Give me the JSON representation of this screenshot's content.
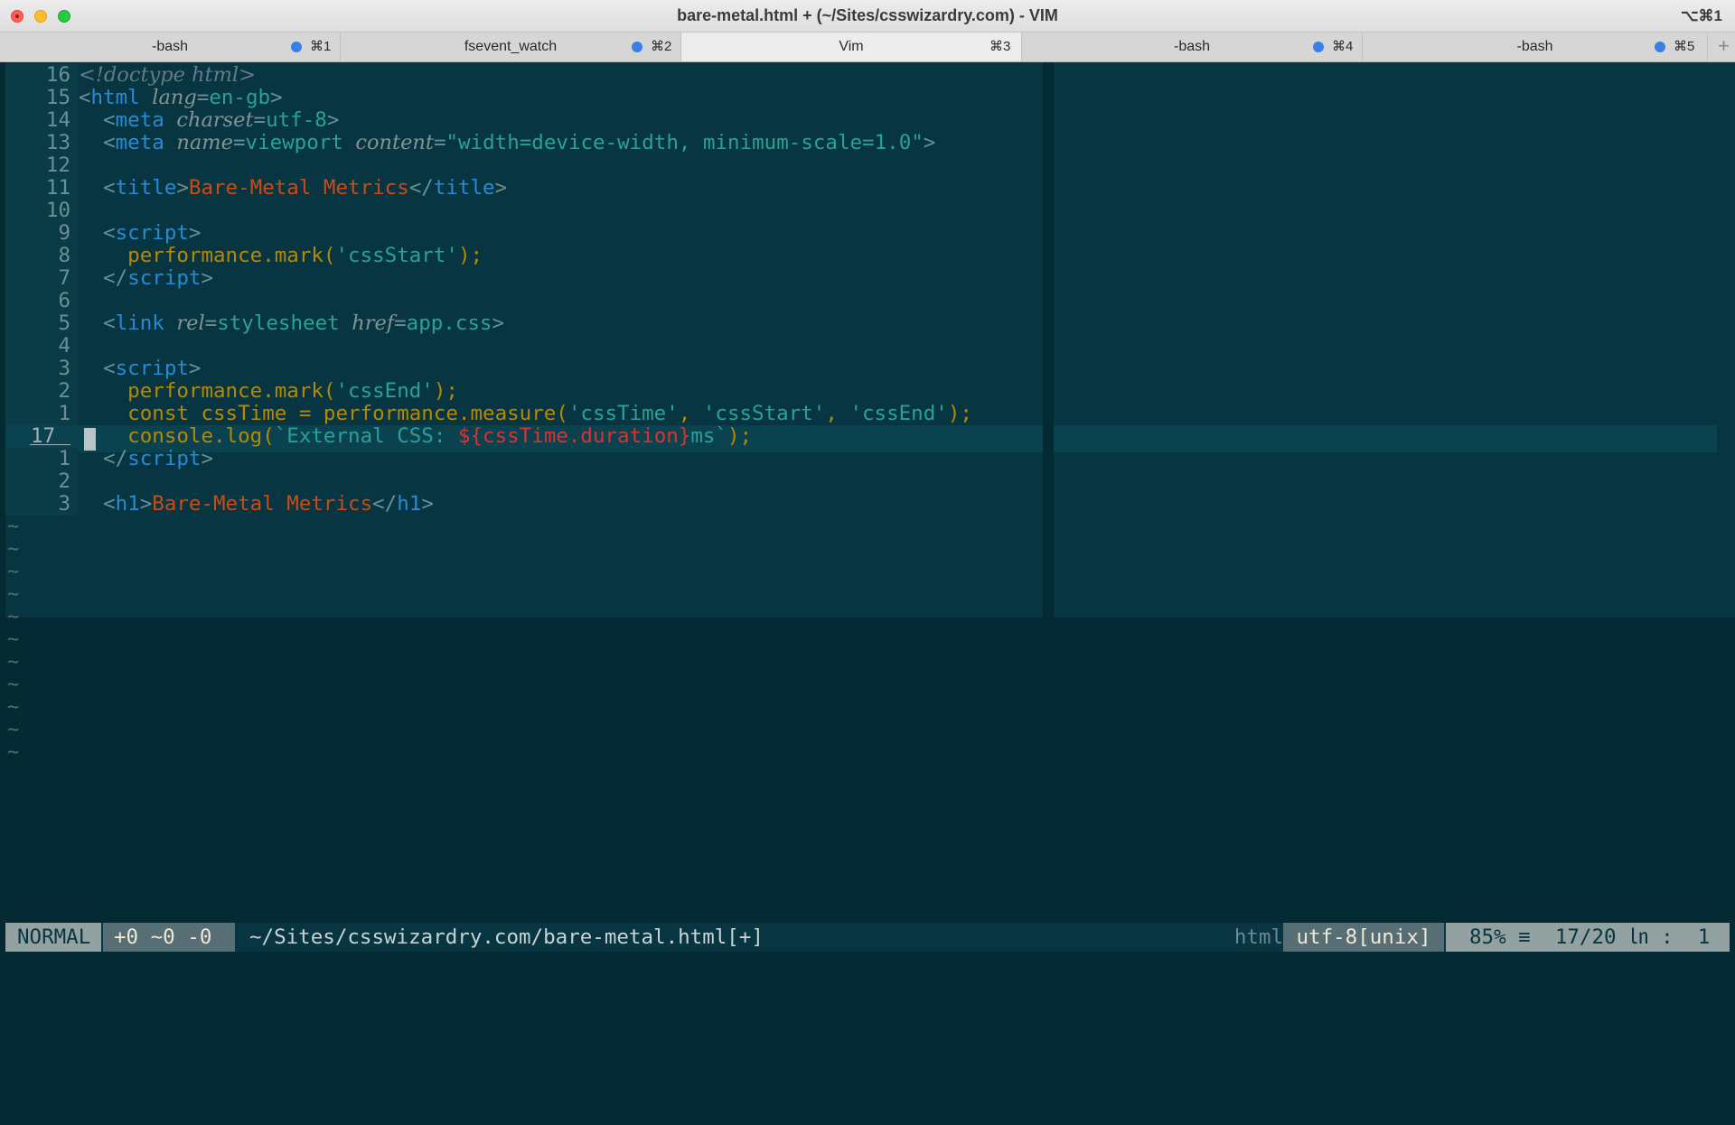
{
  "window": {
    "title": "bare-metal.html + (~/Sites/csswizardry.com) - VIM",
    "shortcut": "⌥⌘1"
  },
  "tabs": [
    {
      "label": "-bash",
      "shortcut": "⌘1",
      "activity_dot": true,
      "active": false
    },
    {
      "label": "fsevent_watch",
      "shortcut": "⌘2",
      "activity_dot": true,
      "active": false
    },
    {
      "label": "Vim",
      "shortcut": "⌘3",
      "activity_dot": false,
      "active": true
    },
    {
      "label": "-bash",
      "shortcut": "⌘4",
      "activity_dot": true,
      "active": false
    },
    {
      "label": "-bash",
      "shortcut": "⌘5",
      "activity_dot": true,
      "active": false
    }
  ],
  "tab_add_label": "+",
  "editor": {
    "theme_colors": {
      "background": "#042a33",
      "pane": "#073642",
      "tag": "#268bd2",
      "attr_value": "#2aa198",
      "text": "#cb4b16",
      "js": "#b58900",
      "interp": "#dc322f"
    },
    "lines": [
      {
        "num": "16",
        "tokens": [
          [
            "cm",
            "<!doctype html>"
          ]
        ]
      },
      {
        "num": "15",
        "tokens": [
          [
            "tg",
            "<"
          ],
          [
            "tn",
            "html"
          ],
          [
            "tg",
            " "
          ],
          [
            "at",
            "lang"
          ],
          [
            "tg",
            "="
          ],
          [
            "av",
            "en-gb"
          ],
          [
            "tg",
            ">"
          ]
        ]
      },
      {
        "num": "14",
        "tokens": [
          [
            "tg",
            "  <"
          ],
          [
            "tn",
            "meta"
          ],
          [
            "tg",
            " "
          ],
          [
            "at",
            "charset"
          ],
          [
            "tg",
            "="
          ],
          [
            "av",
            "utf-8"
          ],
          [
            "tg",
            ">"
          ]
        ]
      },
      {
        "num": "13",
        "tokens": [
          [
            "tg",
            "  <"
          ],
          [
            "tn",
            "meta"
          ],
          [
            "tg",
            " "
          ],
          [
            "at",
            "name"
          ],
          [
            "tg",
            "="
          ],
          [
            "av",
            "viewport"
          ],
          [
            "tg",
            " "
          ],
          [
            "at",
            "content"
          ],
          [
            "tg",
            "="
          ],
          [
            "av",
            "\"width=device-width, minimum-scale=1.0\""
          ],
          [
            "tg",
            ">"
          ]
        ]
      },
      {
        "num": "12",
        "tokens": []
      },
      {
        "num": "11",
        "tokens": [
          [
            "tg",
            "  <"
          ],
          [
            "tn",
            "title"
          ],
          [
            "tg",
            ">"
          ],
          [
            "tx",
            "Bare-Metal Metrics"
          ],
          [
            "tg",
            "</"
          ],
          [
            "tn",
            "title"
          ],
          [
            "tg",
            ">"
          ]
        ]
      },
      {
        "num": "10",
        "tokens": []
      },
      {
        "num": "9",
        "tokens": [
          [
            "tg",
            "  <"
          ],
          [
            "tn",
            "script"
          ],
          [
            "tg",
            ">"
          ]
        ]
      },
      {
        "num": "8",
        "tokens": [
          [
            "js",
            "    performance.mark("
          ],
          [
            "st",
            "'cssStart'"
          ],
          [
            "js",
            ");"
          ]
        ]
      },
      {
        "num": "7",
        "tokens": [
          [
            "tg",
            "  </"
          ],
          [
            "tn",
            "script"
          ],
          [
            "tg",
            ">"
          ]
        ]
      },
      {
        "num": "6",
        "tokens": []
      },
      {
        "num": "5",
        "tokens": [
          [
            "tg",
            "  <"
          ],
          [
            "tn",
            "link"
          ],
          [
            "tg",
            " "
          ],
          [
            "at",
            "rel"
          ],
          [
            "tg",
            "="
          ],
          [
            "av",
            "stylesheet"
          ],
          [
            "tg",
            " "
          ],
          [
            "at",
            "href"
          ],
          [
            "tg",
            "="
          ],
          [
            "av",
            "app.css"
          ],
          [
            "tg",
            ">"
          ]
        ]
      },
      {
        "num": "4",
        "tokens": []
      },
      {
        "num": "3",
        "tokens": [
          [
            "tg",
            "  <"
          ],
          [
            "tn",
            "script"
          ],
          [
            "tg",
            ">"
          ]
        ]
      },
      {
        "num": "2",
        "tokens": [
          [
            "js",
            "    performance.mark("
          ],
          [
            "st",
            "'cssEnd'"
          ],
          [
            "js",
            ");"
          ]
        ]
      },
      {
        "num": "1",
        "tokens": [
          [
            "kw",
            "    const cssTime = performance.measure("
          ],
          [
            "st",
            "'cssTime'"
          ],
          [
            "kw",
            ", "
          ],
          [
            "st",
            "'cssStart'"
          ],
          [
            "kw",
            ", "
          ],
          [
            "st",
            "'cssEnd'"
          ],
          [
            "kw",
            ");"
          ]
        ]
      },
      {
        "num": "17",
        "current": true,
        "tokens": [
          [
            "js",
            "    console.log("
          ],
          [
            "st",
            "`External CSS: "
          ],
          [
            "ip",
            "${cssTime.duration}"
          ],
          [
            "st",
            "ms`"
          ],
          [
            "js",
            ");"
          ]
        ]
      },
      {
        "num": "1",
        "tokens": [
          [
            "tg",
            "  </"
          ],
          [
            "tn",
            "script"
          ],
          [
            "tg",
            ">"
          ]
        ]
      },
      {
        "num": "2",
        "tokens": []
      },
      {
        "num": "3",
        "tokens": [
          [
            "tg",
            "  <"
          ],
          [
            "tn",
            "h1"
          ],
          [
            "tg",
            ">"
          ],
          [
            "tx",
            "Bare-Metal Metrics"
          ],
          [
            "tg",
            "</"
          ],
          [
            "tn",
            "h1"
          ],
          [
            "tg",
            ">"
          ]
        ]
      }
    ],
    "tilde_char": "~",
    "tilde_count": 11
  },
  "statusline": {
    "mode": "NORMAL",
    "diff": "+0 ~0 -0",
    "file": "~/Sites/csswizardry.com/bare-metal.html[+]",
    "filetype": "html",
    "encoding": "utf-8[unix]",
    "position": "85% ≡  17/20 ㏑ :  1"
  }
}
